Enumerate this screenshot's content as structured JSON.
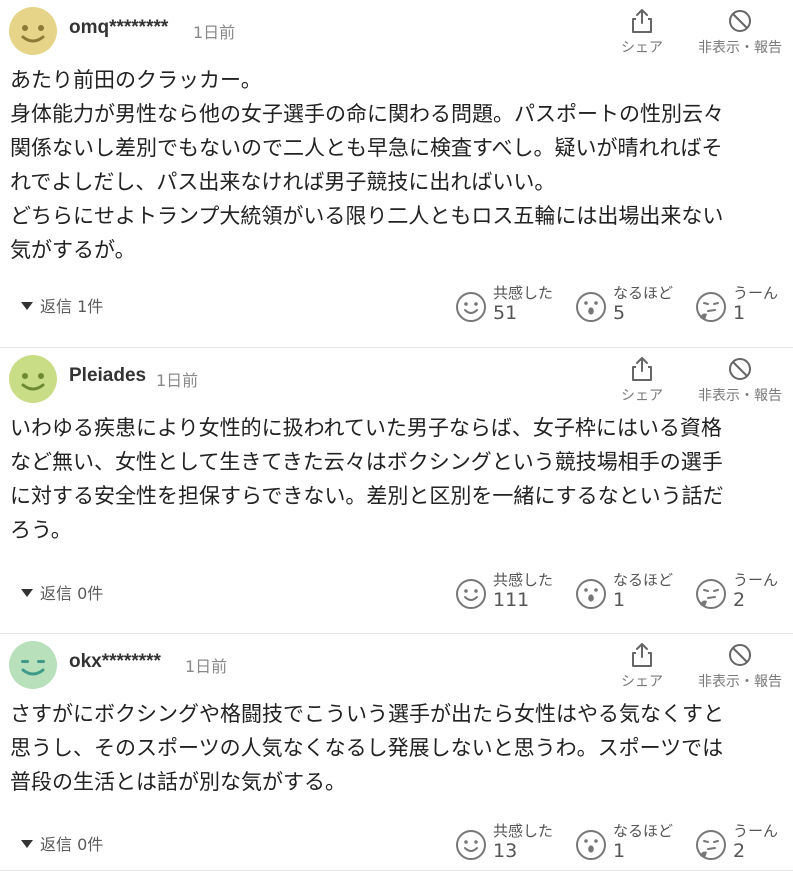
{
  "colors": {
    "avatar_1": "#e6d488",
    "avatar_2": "#c9dc86",
    "avatar_3": "#b7e0bb"
  },
  "actions": {
    "share_label": "シェア",
    "hide_label": "非表示・報告"
  },
  "reactions_labels": {
    "empathy": "共感した",
    "insight": "なるほど",
    "hmm": "うーん"
  },
  "comments": [
    {
      "username": "omq********",
      "time": "1日前",
      "lines": [
        "あたり前田のクラッカー。",
        "身体能力が男性なら他の女子選手の命に関わる問題。パスポートの性別云々",
        "関係ないし差別でもないので二人とも早急に検査すべし。疑いが晴れればそ",
        "れでよしだし、パス出来なければ男子競技に出ればいい。",
        "どちらにせよトランプ大統領がいる限り二人ともロス五輪には出場出来ない",
        "気がするが。"
      ],
      "replies": "返信 1件",
      "reactions": {
        "empathy": "51",
        "insight": "5",
        "hmm": "1"
      }
    },
    {
      "username": "Pleiades",
      "time": "1日前",
      "lines": [
        "いわゆる疾患により女性的に扱われていた男子ならば、女子枠にはいる資格",
        "など無い、女性として生きてきた云々はボクシングという競技場相手の選手",
        "に対する安全性を担保すらできない。差別と区別を一緒にするなという話だ",
        "ろう。"
      ],
      "replies": "返信 0件",
      "reactions": {
        "empathy": "111",
        "insight": "1",
        "hmm": "2"
      }
    },
    {
      "username": "okx********",
      "time": "1日前",
      "lines": [
        "さすがにボクシングや格闘技でこういう選手が出たら女性はやる気なくすと",
        "思うし、そのスポーツの人気なくなるし発展しないと思うわ。スポーツでは",
        "普段の生活とは話が別な気がする。"
      ],
      "replies": "返信 0件",
      "reactions": {
        "empathy": "13",
        "insight": "1",
        "hmm": "2"
      }
    }
  ]
}
